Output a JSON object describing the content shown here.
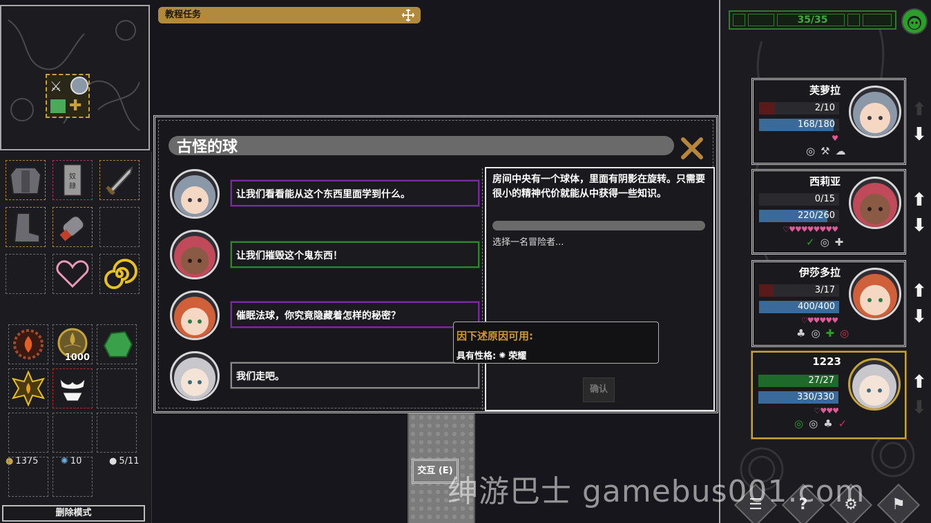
{
  "quest": {
    "title": "教程任务"
  },
  "inventory": {
    "item_quantity": "1000",
    "resources": {
      "gold": "1375",
      "gems": "10",
      "supplies": "5/11"
    },
    "delete_mode_label": "删除模式"
  },
  "event": {
    "title": "古怪的球",
    "choices": [
      {
        "text": "让我们看看能从这个东西里面学到什么。",
        "style": "purple"
      },
      {
        "text": "让我们摧毁这个鬼东西！",
        "style": "green"
      },
      {
        "text": "催眠法球，你究竟隐藏着怎样的秘密？",
        "style": "purple"
      },
      {
        "text": "我们走吧。",
        "style": "gray"
      }
    ],
    "description": "房间中央有一个球体，里面有阴影在旋转。只需要很小的精神代价就能从中获得一些知识。",
    "prompt": "选择一名冒险者...",
    "confirm_label": "确认"
  },
  "tooltip": {
    "title": "因下述原因可用:",
    "label": "具有性格:",
    "trait": "荣耀"
  },
  "interact_label": "交互 (E)",
  "party": {
    "counter": "35/35",
    "heroes": [
      {
        "name": "芙萝拉",
        "hp": "2/10",
        "hp_frac": 0.2,
        "mp": "168/180",
        "mp_frac": 0.93,
        "hearts": "♥",
        "traits": [
          "◎",
          "⚒",
          "☁"
        ],
        "hair": "#8a98a8",
        "skin": "#f4d8c4"
      },
      {
        "name": "西莉亚",
        "hp": "0/15",
        "hp_frac": 0.0,
        "mp": "220/260",
        "mp_frac": 0.85,
        "hearts": "♡♥♥♥♥♥♥♥♥",
        "traits": [
          "✓",
          "◎",
          "✚"
        ],
        "hair": "#c04a5a",
        "skin": "#8a5a44"
      },
      {
        "name": "伊莎多拉",
        "hp": "3/17",
        "hp_frac": 0.18,
        "mp": "400/400",
        "mp_frac": 1.0,
        "hearts": "♡♥♥♥♥♥",
        "traits": [
          "♣",
          "◎",
          "✚",
          "◎"
        ],
        "hair": "#d0603a",
        "skin": "#f4d8c4"
      },
      {
        "name": "1223",
        "hp": "27/27",
        "hp_frac": 1.0,
        "mp": "330/330",
        "mp_frac": 1.0,
        "hearts": "♡♥♥♥",
        "traits": [
          "◎",
          "◎",
          "♣",
          "✓"
        ],
        "hair": "#c8c8cc",
        "skin": "#f4e4d8"
      }
    ]
  },
  "watermark": "绅游巴士 gamebus001.com",
  "colors": {
    "gold": "#b18a3e",
    "accent_green": "#2c7d2c",
    "hp_red": "#5a1a1a",
    "mp_blue": "#3a6a9a",
    "heart_pink": "#e05a9a"
  }
}
